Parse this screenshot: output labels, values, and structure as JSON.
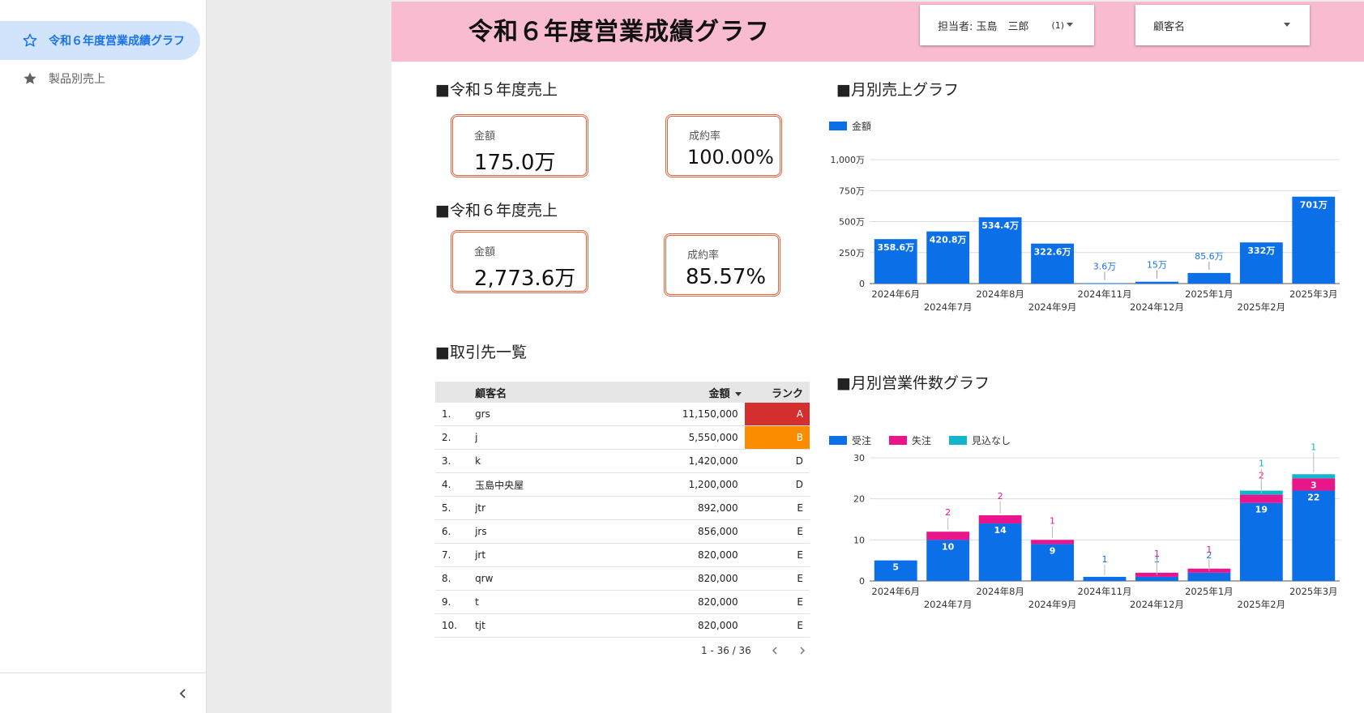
{
  "sidebar": {
    "items": [
      {
        "label": "令和６年度営業成績グラフ",
        "active": true
      },
      {
        "label": "製品別売上",
        "active": false
      }
    ]
  },
  "header": {
    "title": "令和６年度営業成績グラフ",
    "filter_staff": {
      "label": "担当者: 玉島　三郎",
      "count": "(1)"
    },
    "filter_customer": {
      "label": "顧客名"
    }
  },
  "sections": {
    "r5_sales": "■令和５年度売上",
    "r6_sales": "■令和６年度売上",
    "clients": "■取引先一覧",
    "monthly_sales": "■月別売上グラフ",
    "monthly_count": "■月別営業件数グラフ"
  },
  "kpis": {
    "r5_amount": {
      "label": "金額",
      "value": "175.0万"
    },
    "r5_rate": {
      "label": "成約率",
      "value": "100.00%"
    },
    "r6_amount": {
      "label": "金額",
      "value": "2,773.6万"
    },
    "r6_rate": {
      "label": "成約率",
      "value": "85.57%"
    }
  },
  "table": {
    "headers": {
      "name": "顧客名",
      "amount": "金額",
      "rank": "ランク"
    },
    "rows": [
      {
        "idx": "1.",
        "name": "grs",
        "amount": "11,150,000",
        "rank": "A"
      },
      {
        "idx": "2.",
        "name": "j",
        "amount": "5,550,000",
        "rank": "B"
      },
      {
        "idx": "3.",
        "name": "k",
        "amount": "1,420,000",
        "rank": "D"
      },
      {
        "idx": "4.",
        "name": "玉島中央屋",
        "amount": "1,200,000",
        "rank": "D"
      },
      {
        "idx": "5.",
        "name": "jtr",
        "amount": "892,000",
        "rank": "E"
      },
      {
        "idx": "6.",
        "name": "jrs",
        "amount": "856,000",
        "rank": "E"
      },
      {
        "idx": "7.",
        "name": "jrt",
        "amount": "820,000",
        "rank": "E"
      },
      {
        "idx": "8.",
        "name": "qrw",
        "amount": "820,000",
        "rank": "E"
      },
      {
        "idx": "9.",
        "name": "t",
        "amount": "820,000",
        "rank": "E"
      },
      {
        "idx": "10.",
        "name": "tjt",
        "amount": "820,000",
        "rank": "E"
      }
    ],
    "pager": "1 - 36 / 36"
  },
  "chart_data": [
    {
      "type": "bar",
      "title": "■月別売上グラフ",
      "categories": [
        "2024年6月",
        "2024年7月",
        "2024年8月",
        "2024年9月",
        "2024年11月",
        "2024年12月",
        "2025年1月",
        "2025年2月",
        "2025年3月"
      ],
      "series": [
        {
          "name": "金額",
          "values": [
            358.6,
            420.8,
            534.4,
            322.6,
            3.6,
            15,
            85.6,
            332,
            701
          ],
          "color": "#0b6fe8"
        }
      ],
      "value_labels": [
        "358.6万",
        "420.8万",
        "534.4万",
        "322.6万",
        "3.6万",
        "15万",
        "85.6万",
        "332万",
        "701万"
      ],
      "ylim": [
        0,
        1000
      ],
      "yticks": [
        0,
        250,
        500,
        750,
        1000
      ],
      "ytick_labels": [
        "0",
        "250万",
        "500万",
        "750万",
        "1,000万"
      ],
      "legend": "top-left",
      "grid": true
    },
    {
      "type": "bar",
      "stacked": true,
      "title": "■月別営業件数グラフ",
      "categories": [
        "2024年6月",
        "2024年7月",
        "2024年8月",
        "2024年9月",
        "2024年11月",
        "2024年12月",
        "2025年1月",
        "2025年2月",
        "2025年3月"
      ],
      "series": [
        {
          "name": "受注",
          "values": [
            5,
            10,
            14,
            9,
            1,
            1,
            2,
            19,
            22
          ],
          "color": "#0b6fe8"
        },
        {
          "name": "失注",
          "values": [
            0,
            2,
            2,
            1,
            0,
            1,
            1,
            2,
            3
          ],
          "color": "#e8168a"
        },
        {
          "name": "見込なし",
          "values": [
            0,
            0,
            0,
            0,
            0,
            0,
            0,
            1,
            1
          ],
          "color": "#12b5cb"
        }
      ],
      "ylim": [
        0,
        30
      ],
      "yticks": [
        0,
        10,
        20,
        30
      ],
      "legend": "top-left",
      "grid": true
    }
  ],
  "colors": {
    "header_band": "#f8bbd0",
    "kpi_border": "#e4643c",
    "nav_active": "#1a73e8"
  }
}
